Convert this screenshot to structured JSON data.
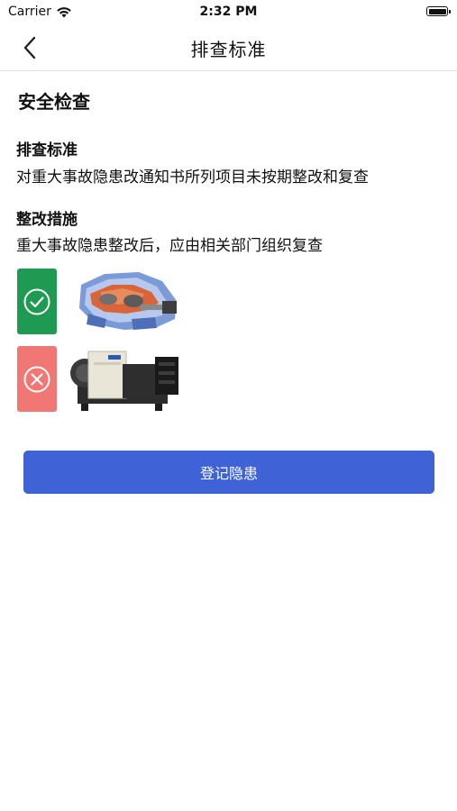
{
  "status_bar": {
    "carrier": "Carrier",
    "time": "2:32 PM"
  },
  "nav": {
    "title": "排查标准",
    "back_icon": "chevron-left-icon"
  },
  "section": {
    "title": "安全检查"
  },
  "standard": {
    "label": "排查标准",
    "text": "对重大事故隐患改通知书所列项目未按期整改和复查"
  },
  "measure": {
    "label": "整改措施",
    "text": "重大事故隐患整改后，应由相关部门组织复查"
  },
  "examples": [
    {
      "status": "pass",
      "icon": "check-circle-icon",
      "color": "#1f9a52",
      "image": "compressor-cutaway-photo"
    },
    {
      "status": "fail",
      "icon": "x-circle-icon",
      "color": "#f07774",
      "image": "compressor-unit-photo"
    }
  ],
  "actions": {
    "register_label": "登记隐患",
    "button_color": "#3f62d6"
  }
}
